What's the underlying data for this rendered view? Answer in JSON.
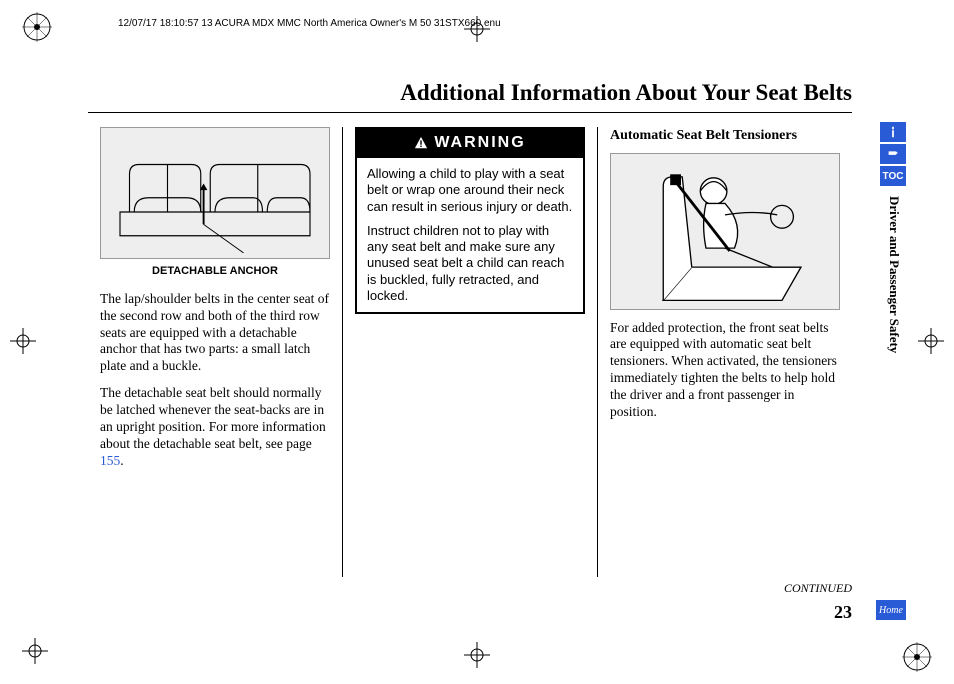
{
  "print_header": "12/07/17 18:10:57   13 ACURA MDX MMC North America Owner's M 50 31STX660 enu",
  "page_title": "Additional Information About Your Seat Belts",
  "section_label": "Driver and Passenger Safety",
  "tabs": {
    "info_name": "info-icon",
    "index_name": "index-icon",
    "toc_label": "TOC",
    "home_label": "Home"
  },
  "col1": {
    "caption": "DETACHABLE ANCHOR",
    "p1": "The lap/shoulder belts in the center seat of the second row and both of the third row seats are equipped with a detachable anchor that has two parts: a small latch plate and a buckle.",
    "p2_a": "The detachable seat belt should normally be latched whenever the seat-backs are in an upright position. For more information about the detachable seat belt, see page ",
    "p2_link": "155",
    "p2_b": "."
  },
  "col2": {
    "warning_label": "WARNING",
    "w_p1": "Allowing a child to play with a seat belt or wrap one around their neck can result in serious injury or death.",
    "w_p2": "Instruct children not to play with any seat belt and make sure any unused seat belt a child can reach is buckled, fully retracted, and locked."
  },
  "col3": {
    "heading": "Automatic Seat Belt Tensioners",
    "p1": "For added protection, the front seat belts are equipped with automatic seat belt tensioners. When activated, the tensioners immediately tighten the belts to help hold the driver and a front passenger in position."
  },
  "continued": "CONTINUED",
  "page_number": "23"
}
